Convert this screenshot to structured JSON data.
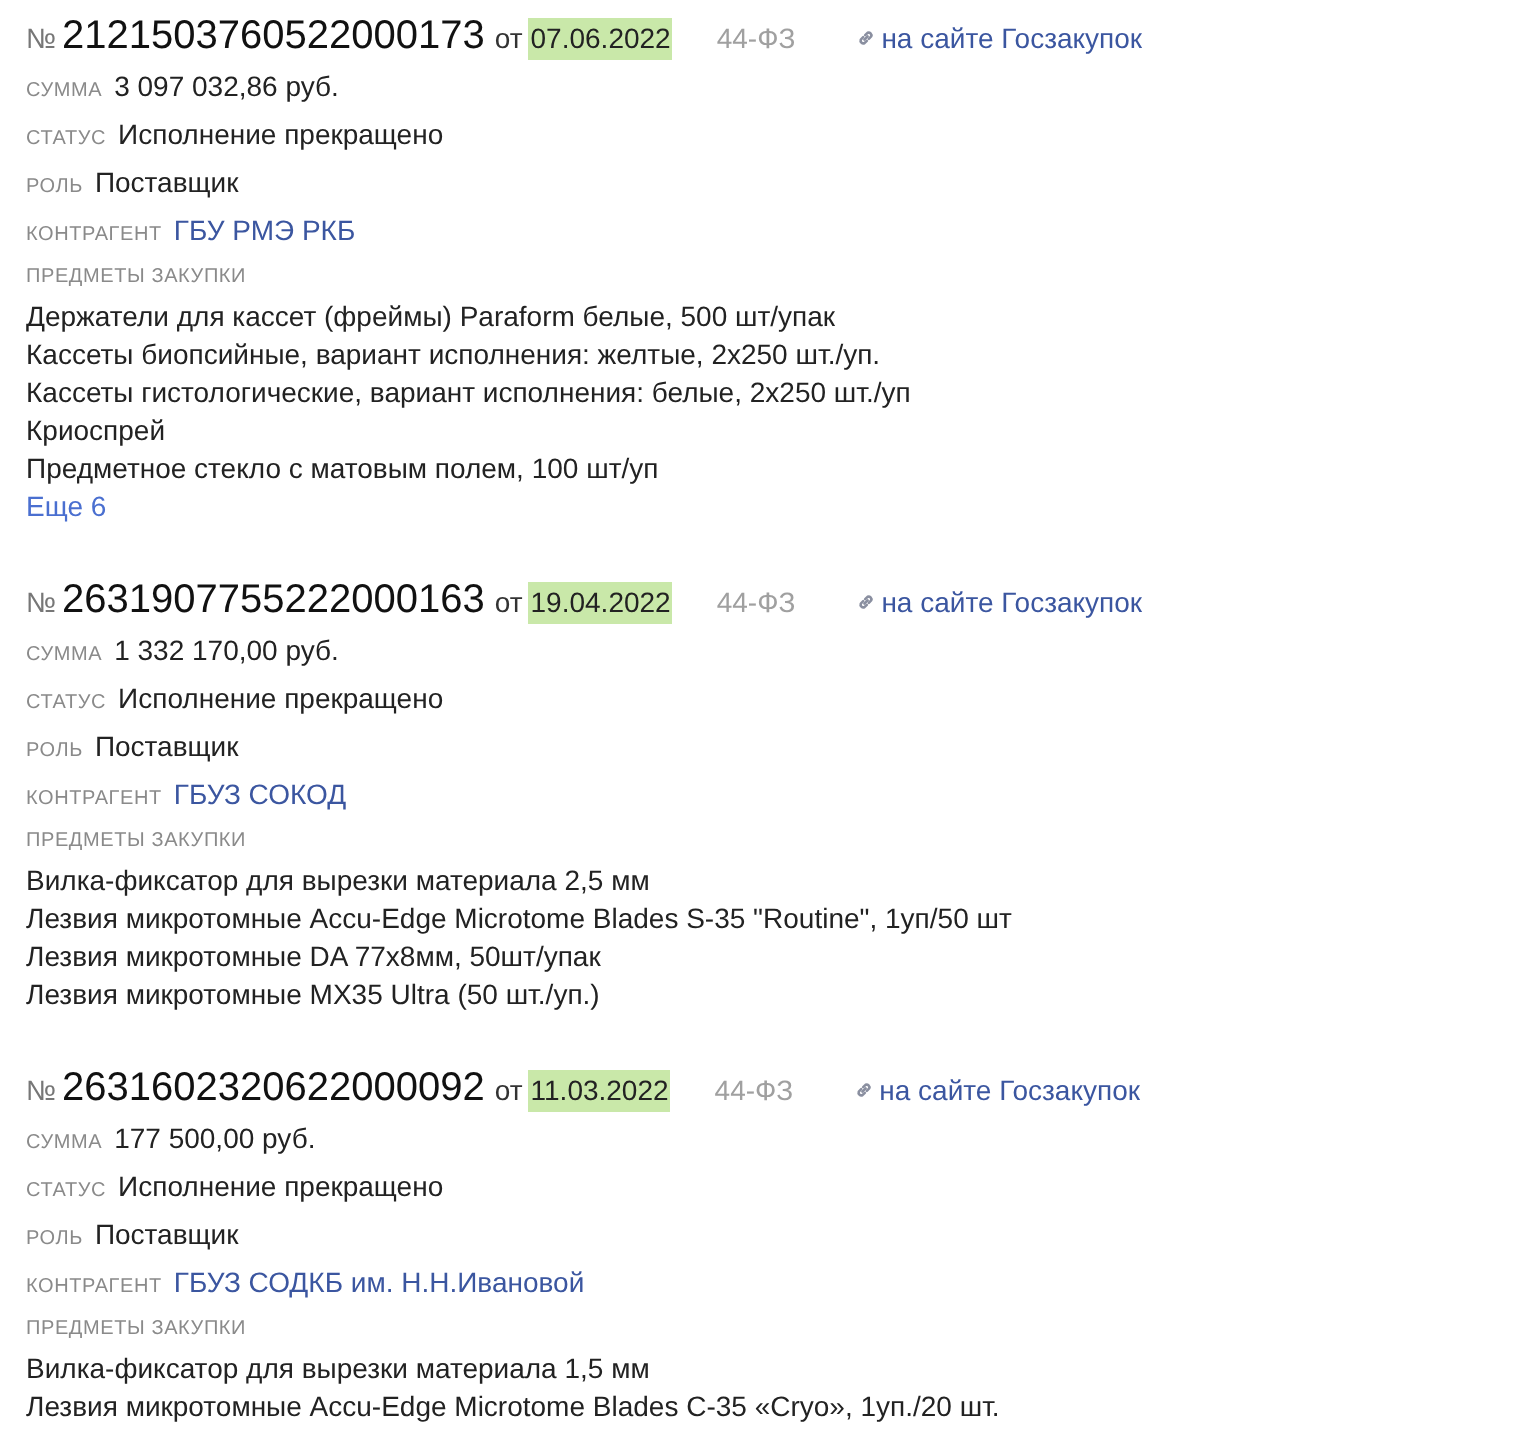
{
  "contracts": [
    {
      "number_sign": "№",
      "number": "2121503760522000173",
      "date_prefix": "от",
      "date": "07.06.2022",
      "law": "44-ФЗ",
      "source_link": "на сайте Госзакупок",
      "fields": [
        {
          "label": "СУММА",
          "value": "3 097 032,86 руб.",
          "kind": "text"
        },
        {
          "label": "СТАТУС",
          "value": "Исполнение прекращено",
          "kind": "text"
        },
        {
          "label": "РОЛЬ",
          "value": "Поставщик",
          "kind": "text"
        },
        {
          "label": "КОНТРАГЕНТ",
          "value": "ГБУ РМЭ РКБ",
          "kind": "link"
        }
      ],
      "subjects_label": "ПРЕДМЕТЫ ЗАКУПКИ",
      "subjects": [
        "Держатели для кассет (фреймы) Paraform белые, 500 шт/упак",
        "Кассеты биопсийные, вариант исполнения: желтые, 2x250 шт./уп.",
        "Кассеты гистологические, вариант исполнения: белые, 2x250 шт./уп",
        "Криоспрей",
        "Предметное стекло с матовым полем, 100 шт/уп"
      ],
      "more": "Еще 6"
    },
    {
      "number_sign": "№",
      "number": "2631907755222000163",
      "date_prefix": "от",
      "date": "19.04.2022",
      "law": "44-ФЗ",
      "source_link": "на сайте Госзакупок",
      "fields": [
        {
          "label": "СУММА",
          "value": "1 332 170,00 руб.",
          "kind": "text"
        },
        {
          "label": "СТАТУС",
          "value": "Исполнение прекращено",
          "kind": "text"
        },
        {
          "label": "РОЛЬ",
          "value": "Поставщик",
          "kind": "text"
        },
        {
          "label": "КОНТРАГЕНТ",
          "value": "ГБУЗ СОКОД",
          "kind": "link"
        }
      ],
      "subjects_label": "ПРЕДМЕТЫ ЗАКУПКИ",
      "subjects": [
        "Вилка-фиксатор для вырезки материала 2,5 мм",
        "Лезвия микротомные Accu-Edge Microtome Blades S-35 \"Routine\", 1уп/50 шт",
        "Лезвия микротомные DA 77x8мм, 50шт/упак",
        "Лезвия микротомные MX35 Ultra (50 шт./уп.)"
      ]
    },
    {
      "number_sign": "№",
      "number": "2631602320622000092",
      "date_prefix": "от",
      "date": "11.03.2022",
      "law": "44-ФЗ",
      "source_link": "на сайте Госзакупок",
      "fields": [
        {
          "label": "СУММА",
          "value": "177 500,00 руб.",
          "kind": "text"
        },
        {
          "label": "СТАТУС",
          "value": "Исполнение прекращено",
          "kind": "text"
        },
        {
          "label": "РОЛЬ",
          "value": "Поставщик",
          "kind": "text"
        },
        {
          "label": "КОНТРАГЕНТ",
          "value": "ГБУЗ СОДКБ им. Н.Н.Ивановой",
          "kind": "link"
        }
      ],
      "subjects_label": "ПРЕДМЕТЫ ЗАКУПКИ",
      "subjects": [
        "Вилка-фиксатор для вырезки материала 1,5 мм",
        "Лезвия микротомные Accu-Edge Microtome Blades C-35 «Cryo», 1уп./20 шт."
      ]
    }
  ]
}
